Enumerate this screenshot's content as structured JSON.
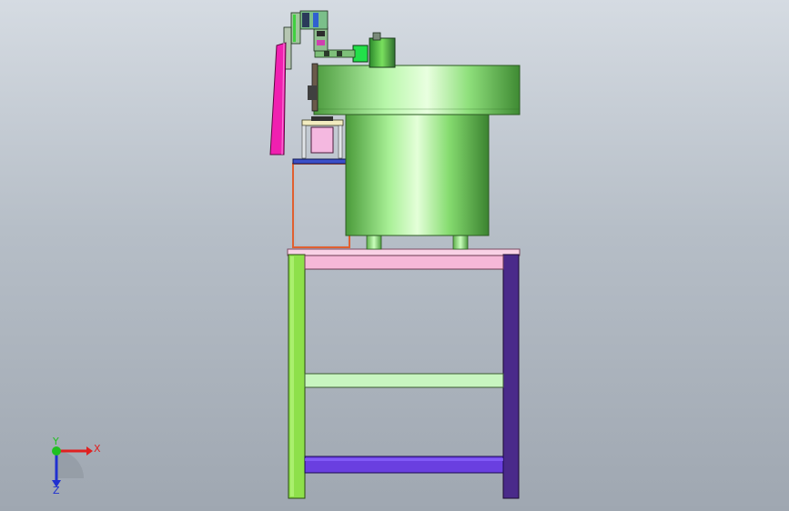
{
  "viewport": {
    "background_top": "#d5dbe2",
    "background_bottom": "#9fa7b1"
  },
  "triad": {
    "x_label": "X",
    "y_label": "Y",
    "z_label": "Z",
    "x_color": "#e02020",
    "y_color": "#20c020",
    "z_color": "#2030d0"
  },
  "colors": {
    "bowl_green": "#9cf08c",
    "bowl_dark": "#5fb84d",
    "stand_pink": "#f6b8d8",
    "stand_light_green": "#c8f5c0",
    "stand_purple": "#6a3fe0",
    "leg_green": "#8ee04a",
    "leg_purple": "#4a2a8a",
    "frame_orange": "#e06030",
    "chute_magenta": "#f020b0",
    "pink_block": "#f4b8e0"
  }
}
